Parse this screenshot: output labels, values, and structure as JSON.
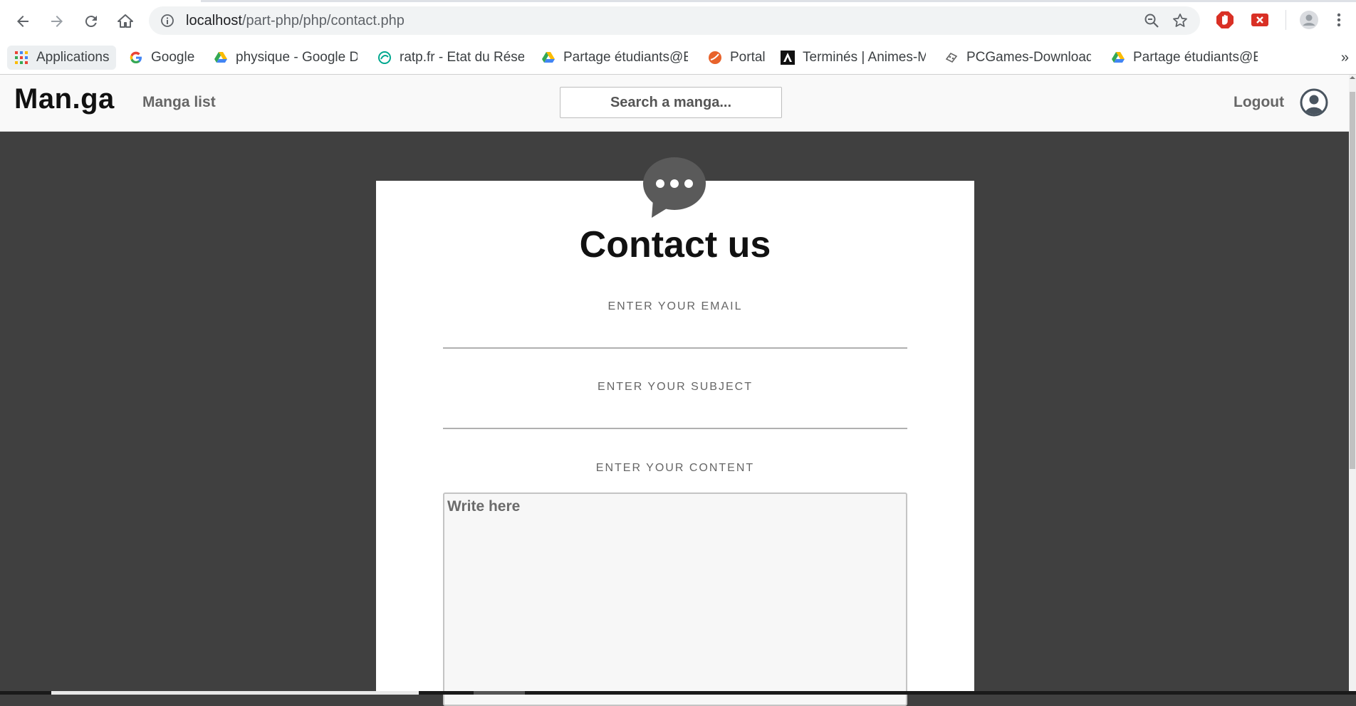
{
  "browser": {
    "url_host": "localhost",
    "url_path": "/part-php/php/contact.php",
    "bookmarks": [
      {
        "label": "Applications",
        "icon": "apps-grid-icon"
      },
      {
        "label": "Google",
        "icon": "google-icon"
      },
      {
        "label": "physique - Google Dr",
        "icon": "google-drive-icon"
      },
      {
        "label": "ratp.fr - Etat du Résea",
        "icon": "ratp-icon"
      },
      {
        "label": "Partage étudiants@EI",
        "icon": "google-drive-icon"
      },
      {
        "label": "Portal",
        "icon": "portal-icon"
      },
      {
        "label": "Terminés | Animes-M",
        "icon": "animes-icon"
      },
      {
        "label": "PCGames-Download",
        "icon": "gamepad-icon"
      },
      {
        "label": "Partage étudiants@EI",
        "icon": "google-drive-icon"
      }
    ],
    "more_bookmarks": "»"
  },
  "site": {
    "logo": "Man.ga",
    "nav_manga_list": "Manga list",
    "search_placeholder": "Search a manga...",
    "logout": "Logout"
  },
  "contact": {
    "title": "Contact us",
    "email_label": "ENTER YOUR EMAIL",
    "subject_label": "ENTER YOUR SUBJECT",
    "content_label": "ENTER YOUR CONTENT",
    "content_placeholder": "Write here"
  },
  "colors": {
    "page_background": "#404040",
    "header_background": "#f9f9f9",
    "card_background": "#ffffff",
    "bubble": "#5a5a5a"
  }
}
